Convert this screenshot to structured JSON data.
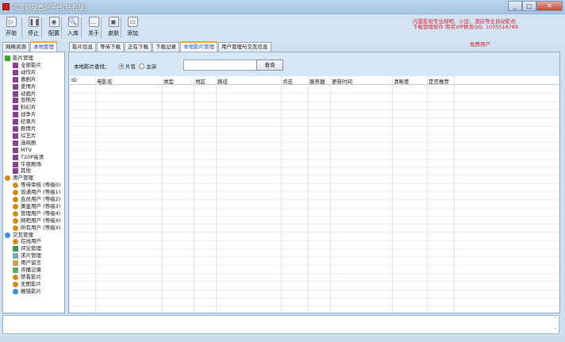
{
  "window": {
    "title": "闪雷影视管理平台[钻石版]",
    "min": "_",
    "max": "□",
    "close": "✕"
  },
  "toolbar": [
    {
      "label": "开始",
      "icon": "play-icon",
      "glyph": "▷"
    },
    {
      "label": "停止",
      "icon": "pause-icon",
      "glyph": "❚❚"
    },
    {
      "label": "配置",
      "icon": "settings-icon",
      "glyph": "◉"
    },
    {
      "label": "入库",
      "icon": "search-icon",
      "glyph": "🔍"
    },
    {
      "label": "关于",
      "icon": "about-icon",
      "glyph": "…"
    },
    {
      "label": "皮肤",
      "icon": "skin-icon",
      "glyph": "▣"
    },
    {
      "label": "添加",
      "icon": "folder-icon",
      "glyph": "▭"
    }
  ],
  "promo": {
    "line1": "闪雷影视专业网吧、小区、酒店等全自动影视",
    "line2": "下载管理软件 购买VIP联系QQ: 1035518789",
    "user": "免费用户"
  },
  "left_tabs": [
    "网络资源",
    "本地管理"
  ],
  "main_tabs": [
    "影片信息",
    "等待下载",
    "正在下载",
    "下载记录",
    "本地影片管理",
    "用户管理与交互信息"
  ],
  "tree": [
    {
      "label": "影片管理",
      "level": 0,
      "icon": "flag"
    },
    {
      "label": "全部影片",
      "level": 1,
      "icon": "film"
    },
    {
      "label": "动作片",
      "level": 1,
      "icon": "film"
    },
    {
      "label": "喜剧片",
      "level": 1,
      "icon": "film"
    },
    {
      "label": "爱情片",
      "level": 1,
      "icon": "film"
    },
    {
      "label": "动画片",
      "level": 1,
      "icon": "film"
    },
    {
      "label": "恐怖片",
      "level": 1,
      "icon": "film"
    },
    {
      "label": "科幻片",
      "level": 1,
      "icon": "film"
    },
    {
      "label": "战争片",
      "level": 1,
      "icon": "film"
    },
    {
      "label": "纪录片",
      "level": 1,
      "icon": "film"
    },
    {
      "label": "剧情片",
      "level": 1,
      "icon": "film"
    },
    {
      "label": "综艺片",
      "level": 1,
      "icon": "film"
    },
    {
      "label": "连续剧",
      "level": 1,
      "icon": "film"
    },
    {
      "label": "MTV",
      "level": 1,
      "icon": "film"
    },
    {
      "label": "T20P高清",
      "level": 1,
      "icon": "film"
    },
    {
      "label": "午夜剧场",
      "level": 1,
      "icon": "film"
    },
    {
      "label": "其他",
      "level": 1,
      "icon": "film"
    },
    {
      "label": "用户管理",
      "level": 0,
      "icon": "user"
    },
    {
      "label": "等待审核 (等级0)",
      "level": 1,
      "icon": "user"
    },
    {
      "label": "普通用户 (等级1)",
      "level": 1,
      "icon": "user"
    },
    {
      "label": "会员用户 (等级2)",
      "level": 1,
      "icon": "user"
    },
    {
      "label": "黄金用户 (等级3)",
      "level": 1,
      "icon": "user"
    },
    {
      "label": "管理用户 (等级4)",
      "level": 1,
      "icon": "user"
    },
    {
      "label": "网吧用户 (等级X)",
      "level": 1,
      "icon": "user"
    },
    {
      "label": "所有用户 (等级X)",
      "level": 1,
      "icon": "user"
    },
    {
      "label": "交互管理",
      "level": 0,
      "icon": "chat"
    },
    {
      "label": "在线用户",
      "level": 1,
      "icon": "user"
    },
    {
      "label": "评论管理",
      "level": 1,
      "icon": "comment"
    },
    {
      "label": "求片管理",
      "level": 1,
      "icon": "search"
    },
    {
      "label": "用户留言",
      "level": 1,
      "icon": "note"
    },
    {
      "label": "点播记录",
      "level": 1,
      "icon": "log"
    },
    {
      "label": "禁看影片",
      "level": 1,
      "icon": "user"
    },
    {
      "label": "无图影片",
      "level": 1,
      "icon": "user"
    },
    {
      "label": "报错影片",
      "level": 1,
      "icon": "chat"
    }
  ],
  "search": {
    "label": "本地影片查找：",
    "options": [
      "片名",
      "主演"
    ],
    "selected": "片名",
    "value": "",
    "button": "查询"
  },
  "table": {
    "columns": [
      "ID",
      "电影名",
      "类型",
      "地区",
      "路径",
      "点击",
      "服务器",
      "更新时间",
      "清晰度",
      "是否推荐"
    ],
    "rows": []
  },
  "log": {
    "up": "⌃",
    "down": "⌄"
  }
}
